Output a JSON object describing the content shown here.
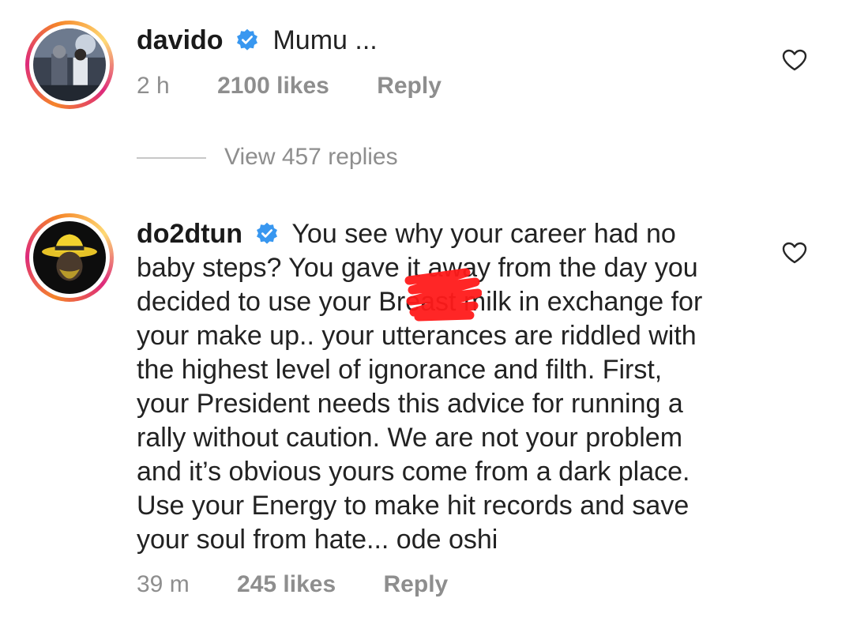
{
  "comments": [
    {
      "username": "davido",
      "verified": true,
      "text": "Mumu ...",
      "time": "2 h",
      "likes": "2100 likes",
      "reply": "Reply"
    },
    {
      "username": "do2dtun",
      "verified": true,
      "text_lines": [
        "You see why your career had no",
        "baby steps? You gave it away from the day you",
        "decided to use your Breast milk in exchange for",
        "your make up.. your utterances are riddled with",
        "the highest level of ignorance and filth. First,",
        "your President needs this advice for running a",
        "rally without caution. We are not your problem",
        "and it’s obvious yours come from a dark place.",
        "Use your Energy to make hit records and save",
        "your soul from hate... ode oshi"
      ],
      "time": "39 m",
      "likes": "245 likes",
      "reply": "Reply"
    }
  ],
  "view_replies": "View 457 replies",
  "colors": {
    "text": "#222222",
    "meta": "#8e8e8e",
    "verified": "#3897f0",
    "redaction": "#ff1a1a"
  },
  "icons": [
    "verified-badge-icon",
    "heart-icon"
  ]
}
